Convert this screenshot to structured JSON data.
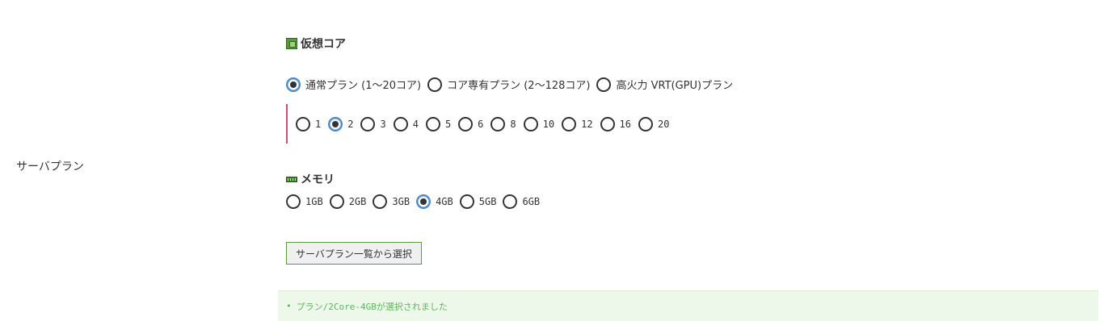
{
  "row_label": "サーバプラン",
  "cpu_section": {
    "title": "仮想コア",
    "icon": "cpu-icon",
    "plan_options": [
      {
        "label": "通常プラン (1〜20コア)",
        "checked": true
      },
      {
        "label": "コア専有プラン (2〜128コア)",
        "checked": false
      },
      {
        "label": "高火力 VRT(GPU)プラン",
        "checked": false
      }
    ],
    "core_options": [
      {
        "label": "1",
        "checked": false
      },
      {
        "label": "2",
        "checked": true
      },
      {
        "label": "3",
        "checked": false
      },
      {
        "label": "4",
        "checked": false
      },
      {
        "label": "5",
        "checked": false
      },
      {
        "label": "6",
        "checked": false
      },
      {
        "label": "8",
        "checked": false
      },
      {
        "label": "10",
        "checked": false
      },
      {
        "label": "12",
        "checked": false
      },
      {
        "label": "16",
        "checked": false
      },
      {
        "label": "20",
        "checked": false
      }
    ]
  },
  "memory_section": {
    "title": "メモリ",
    "icon": "memory-icon",
    "options": [
      {
        "label": "1GB",
        "checked": false
      },
      {
        "label": "2GB",
        "checked": false
      },
      {
        "label": "3GB",
        "checked": false
      },
      {
        "label": "4GB",
        "checked": true
      },
      {
        "label": "5GB",
        "checked": false
      },
      {
        "label": "6GB",
        "checked": false
      }
    ]
  },
  "select_button_label": "サーバプラン一覧から選択",
  "status_message": "プラン/2Core-4GBが選択されました",
  "colors": {
    "accent_blue": "#4a87c6",
    "core_group_border": "#c94f7c",
    "status_bg": "#eef8ea",
    "status_text": "#5cb85c"
  }
}
